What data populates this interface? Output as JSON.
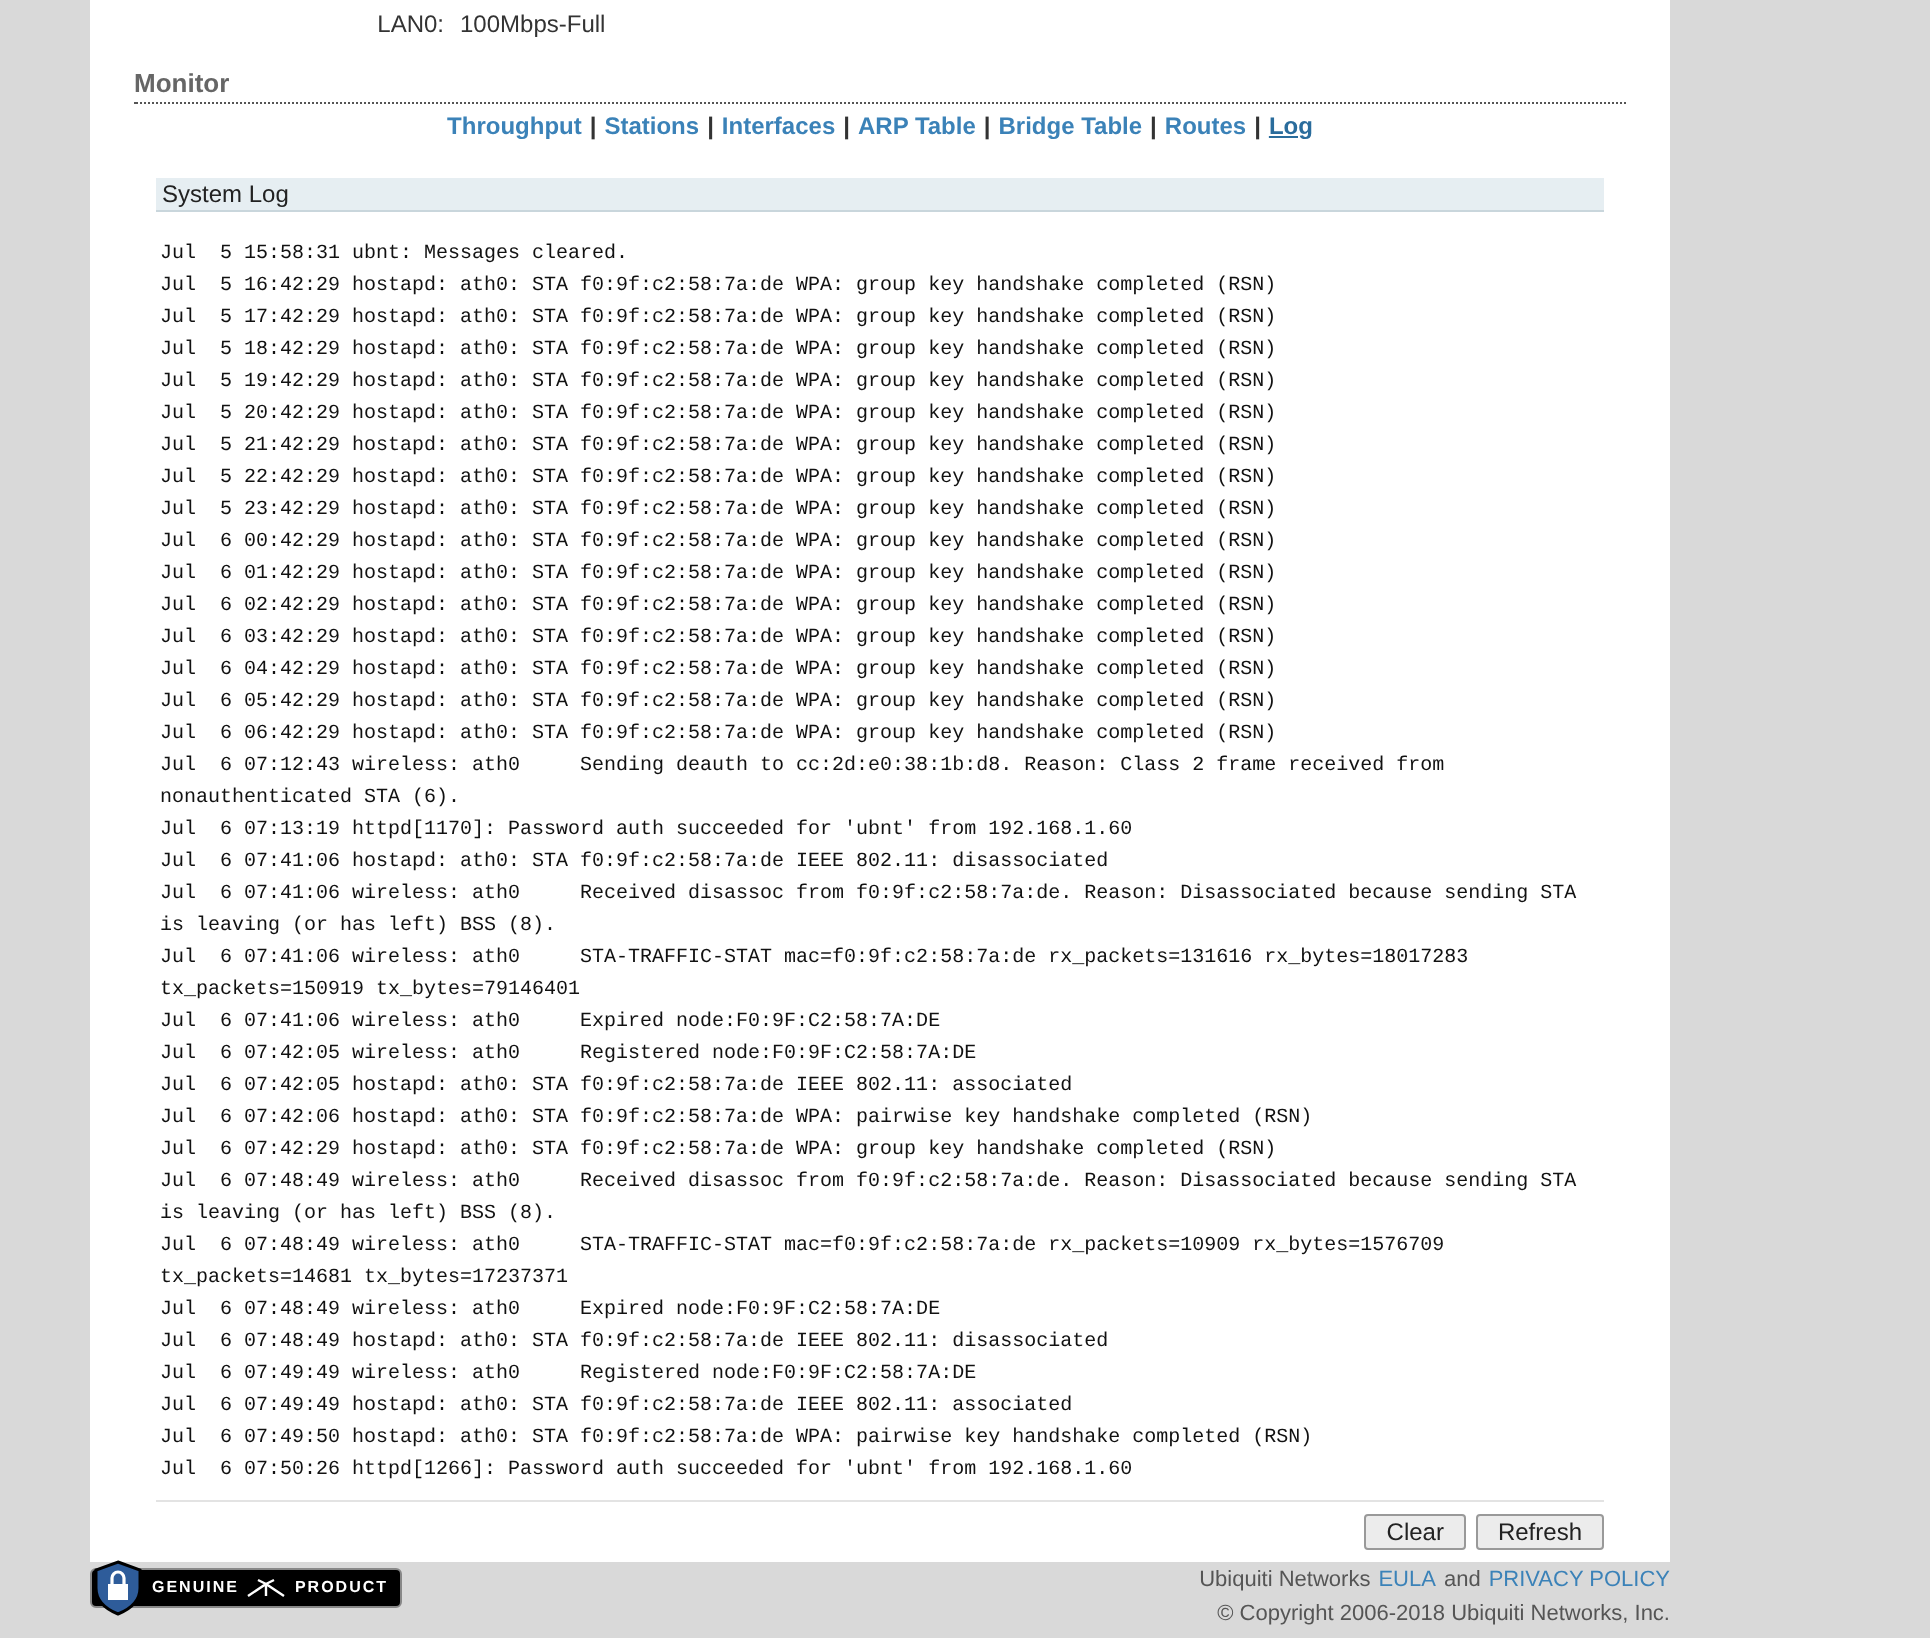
{
  "info_rows": [
    {
      "label": "LAN0:",
      "value": "100Mbps-Full"
    }
  ],
  "section": {
    "title": "Monitor"
  },
  "nav": {
    "separator": "|",
    "items": [
      {
        "label": "Throughput",
        "selected": false
      },
      {
        "label": "Stations",
        "selected": false
      },
      {
        "label": "Interfaces",
        "selected": false
      },
      {
        "label": "ARP Table",
        "selected": false
      },
      {
        "label": "Bridge Table",
        "selected": false
      },
      {
        "label": "Routes",
        "selected": false
      },
      {
        "label": "Log",
        "selected": true
      }
    ]
  },
  "log": {
    "title": "System Log",
    "lines": [
      "Jul  5 15:58:31 ubnt: Messages cleared.",
      "Jul  5 16:42:29 hostapd: ath0: STA f0:9f:c2:58:7a:de WPA: group key handshake completed (RSN)",
      "Jul  5 17:42:29 hostapd: ath0: STA f0:9f:c2:58:7a:de WPA: group key handshake completed (RSN)",
      "Jul  5 18:42:29 hostapd: ath0: STA f0:9f:c2:58:7a:de WPA: group key handshake completed (RSN)",
      "Jul  5 19:42:29 hostapd: ath0: STA f0:9f:c2:58:7a:de WPA: group key handshake completed (RSN)",
      "Jul  5 20:42:29 hostapd: ath0: STA f0:9f:c2:58:7a:de WPA: group key handshake completed (RSN)",
      "Jul  5 21:42:29 hostapd: ath0: STA f0:9f:c2:58:7a:de WPA: group key handshake completed (RSN)",
      "Jul  5 22:42:29 hostapd: ath0: STA f0:9f:c2:58:7a:de WPA: group key handshake completed (RSN)",
      "Jul  5 23:42:29 hostapd: ath0: STA f0:9f:c2:58:7a:de WPA: group key handshake completed (RSN)",
      "Jul  6 00:42:29 hostapd: ath0: STA f0:9f:c2:58:7a:de WPA: group key handshake completed (RSN)",
      "Jul  6 01:42:29 hostapd: ath0: STA f0:9f:c2:58:7a:de WPA: group key handshake completed (RSN)",
      "Jul  6 02:42:29 hostapd: ath0: STA f0:9f:c2:58:7a:de WPA: group key handshake completed (RSN)",
      "Jul  6 03:42:29 hostapd: ath0: STA f0:9f:c2:58:7a:de WPA: group key handshake completed (RSN)",
      "Jul  6 04:42:29 hostapd: ath0: STA f0:9f:c2:58:7a:de WPA: group key handshake completed (RSN)",
      "Jul  6 05:42:29 hostapd: ath0: STA f0:9f:c2:58:7a:de WPA: group key handshake completed (RSN)",
      "Jul  6 06:42:29 hostapd: ath0: STA f0:9f:c2:58:7a:de WPA: group key handshake completed (RSN)",
      "Jul  6 07:12:43 wireless: ath0     Sending deauth to cc:2d:e0:38:1b:d8. Reason: Class 2 frame received from nonauthenticated STA (6).",
      "Jul  6 07:13:19 httpd[1170]: Password auth succeeded for 'ubnt' from 192.168.1.60",
      "Jul  6 07:41:06 hostapd: ath0: STA f0:9f:c2:58:7a:de IEEE 802.11: disassociated",
      "Jul  6 07:41:06 wireless: ath0     Received disassoc from f0:9f:c2:58:7a:de. Reason: Disassociated because sending STA is leaving (or has left) BSS (8).",
      "Jul  6 07:41:06 wireless: ath0     STA-TRAFFIC-STAT mac=f0:9f:c2:58:7a:de rx_packets=131616 rx_bytes=18017283 tx_packets=150919 tx_bytes=79146401",
      "Jul  6 07:41:06 wireless: ath0     Expired node:F0:9F:C2:58:7A:DE",
      "Jul  6 07:42:05 wireless: ath0     Registered node:F0:9F:C2:58:7A:DE",
      "Jul  6 07:42:05 hostapd: ath0: STA f0:9f:c2:58:7a:de IEEE 802.11: associated",
      "Jul  6 07:42:06 hostapd: ath0: STA f0:9f:c2:58:7a:de WPA: pairwise key handshake completed (RSN)",
      "Jul  6 07:42:29 hostapd: ath0: STA f0:9f:c2:58:7a:de WPA: group key handshake completed (RSN)",
      "Jul  6 07:48:49 wireless: ath0     Received disassoc from f0:9f:c2:58:7a:de. Reason: Disassociated because sending STA is leaving (or has left) BSS (8).",
      "Jul  6 07:48:49 wireless: ath0     STA-TRAFFIC-STAT mac=f0:9f:c2:58:7a:de rx_packets=10909 rx_bytes=1576709 tx_packets=14681 tx_bytes=17237371",
      "Jul  6 07:48:49 wireless: ath0     Expired node:F0:9F:C2:58:7A:DE",
      "Jul  6 07:48:49 hostapd: ath0: STA f0:9f:c2:58:7a:de IEEE 802.11: disassociated",
      "Jul  6 07:49:49 wireless: ath0     Registered node:F0:9F:C2:58:7A:DE",
      "Jul  6 07:49:49 hostapd: ath0: STA f0:9f:c2:58:7a:de IEEE 802.11: associated",
      "Jul  6 07:49:50 hostapd: ath0: STA f0:9f:c2:58:7a:de WPA: pairwise key handshake completed (RSN)",
      "Jul  6 07:50:26 httpd[1266]: Password auth succeeded for 'ubnt' from 192.168.1.60"
    ]
  },
  "buttons": [
    "Clear",
    "Refresh"
  ],
  "footer": {
    "badge_left": "GENUINE",
    "badge_right": "PRODUCT",
    "company": "Ubiquiti Networks",
    "eula": "EULA",
    "and": "and",
    "privacy": "PRIVACY POLICY",
    "copyright": "© Copyright 2006-2018 Ubiquiti Networks, Inc."
  }
}
